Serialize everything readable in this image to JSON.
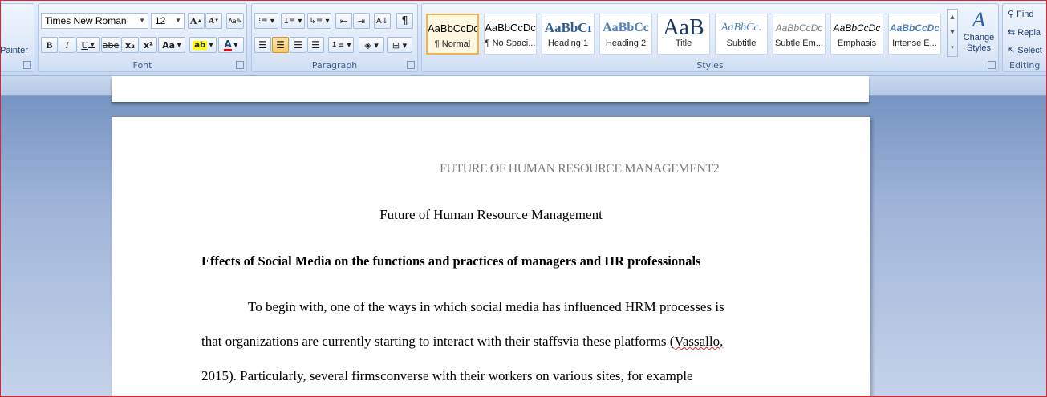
{
  "ribbon": {
    "clipboard": {
      "format_painter_label": "Painter"
    },
    "font": {
      "label": "Font",
      "font_name": "Times New Roman",
      "font_size": "12",
      "grow_icon": "A",
      "shrink_icon": "A",
      "bold": "B",
      "italic": "I",
      "underline": "U",
      "strike": "abe",
      "subscript": "x₂",
      "superscript": "x²",
      "change_case": "Aa",
      "font_color": "A"
    },
    "paragraph": {
      "label": "Paragraph",
      "pilcrow": "¶"
    },
    "styles": {
      "label": "Styles",
      "items": [
        {
          "sample": "AaBbCcDc",
          "name": "¶ Normal"
        },
        {
          "sample": "AaBbCcDc",
          "name": "¶ No Spaci..."
        },
        {
          "sample": "AaBbCı",
          "name": "Heading 1"
        },
        {
          "sample": "AaBbCc",
          "name": "Heading 2"
        },
        {
          "sample": "AaB",
          "name": "Title"
        },
        {
          "sample": "AaBbCc.",
          "name": "Subtitle"
        },
        {
          "sample": "AaBbCcDc",
          "name": "Subtle Em..."
        },
        {
          "sample": "AaBbCcDc",
          "name": "Emphasis"
        },
        {
          "sample": "AaBbCcDc",
          "name": "Intense E..."
        }
      ],
      "change_styles_label": "Change Styles"
    },
    "editing": {
      "label": "Editing",
      "find": "Find",
      "replace": "Repla",
      "select": "Select"
    }
  },
  "document": {
    "header": "FUTURE OF HUMAN RESOURCE MANAGEMENT2",
    "title": "Future of Human Resource Management",
    "heading": "Effects of Social Media on the functions and practices of managers and HR professionals",
    "lines": [
      "To begin with, one of the ways in which social media has influenced HRM processes is",
      "that organizations are currently starting to interact with their staffsvia these platforms (",
      "Vassallo,",
      "2015). Particularly, several firmsconverse with their workers on various sites,  for example"
    ]
  },
  "colors": {
    "accent": "#e0242e",
    "ribbon_text": "#3e5f8c",
    "header_gray": "#7d7d7d"
  }
}
